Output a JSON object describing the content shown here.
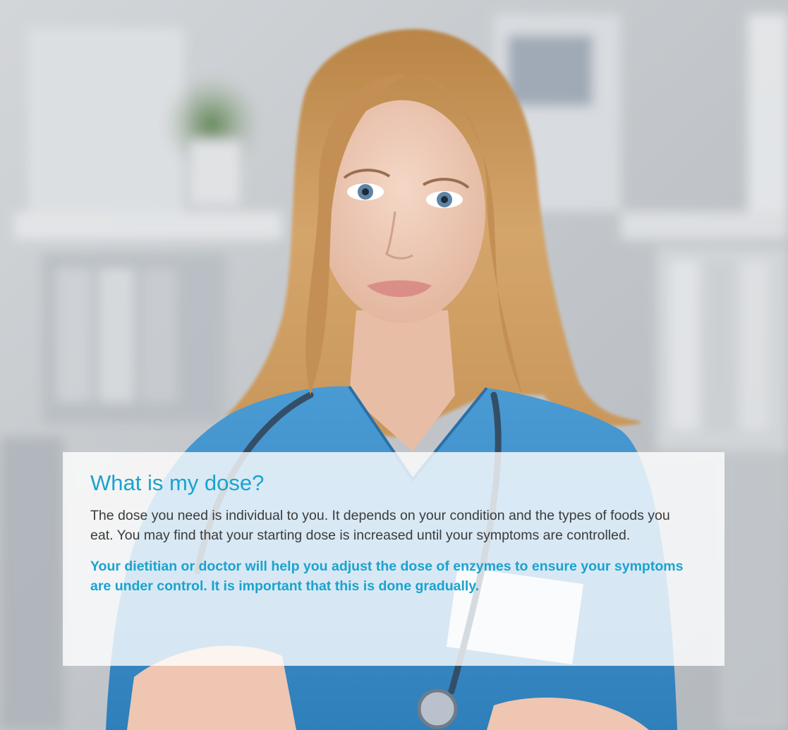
{
  "card": {
    "title": "What is my dose?",
    "body": "The dose you need is individual to you. It depends on your condition and the types of foods you eat. You may find that your starting dose is increased until your symptoms are controlled.",
    "highlight": "Your dietitian or doctor will help you adjust the dose of enzymes to ensure your symptoms are under control. It is important that this is done gradually."
  },
  "colors": {
    "accent": "#1aa3cf",
    "body_text": "#3b3b3b",
    "scrubs": "#3f8fc9",
    "hair": "#c8955a",
    "background": "#c9ccd0"
  },
  "photo": {
    "subject": "healthcare-worker-portrait"
  }
}
